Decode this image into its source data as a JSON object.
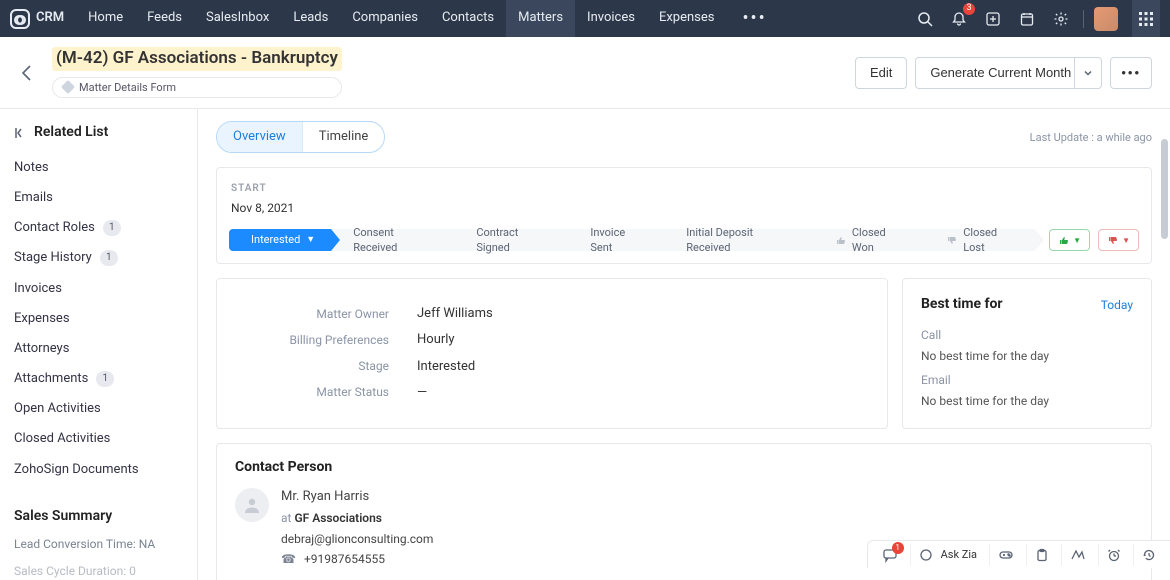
{
  "brand": "CRM",
  "nav": {
    "items": [
      "Home",
      "Feeds",
      "SalesInbox",
      "Leads",
      "Companies",
      "Contacts",
      "Matters",
      "Invoices",
      "Expenses"
    ],
    "active_index": 6
  },
  "notif_count": "3",
  "header": {
    "title": "(M-42) GF Associations - Bankruptcy",
    "tag": "Matter Details Form",
    "edit": "Edit",
    "generate": "Generate Current Month I…"
  },
  "sidebar": {
    "title": "Related List",
    "items": [
      {
        "label": "Notes"
      },
      {
        "label": "Emails"
      },
      {
        "label": "Contact Roles",
        "count": "1"
      },
      {
        "label": "Stage History",
        "count": "1"
      },
      {
        "label": "Invoices"
      },
      {
        "label": "Expenses"
      },
      {
        "label": "Attorneys"
      },
      {
        "label": "Attachments",
        "count": "1"
      },
      {
        "label": "Open Activities"
      },
      {
        "label": "Closed Activities"
      },
      {
        "label": "ZohoSign Documents"
      }
    ],
    "section": "Sales Summary",
    "kv1": "Lead Conversion Time: NA",
    "kv2": "Sales Cycle Duration: 0"
  },
  "tabs": {
    "overview": "Overview",
    "timeline": "Timeline"
  },
  "last_update": "Last Update : a while ago",
  "stage": {
    "start_label": "START",
    "start_date": "Nov 8, 2021",
    "segments": [
      "Interested",
      "Consent Received",
      "Contract Signed",
      "Invoice Sent",
      "Initial Deposit Received",
      "Closed Won",
      "Closed Lost"
    ],
    "active_index": 0
  },
  "info": {
    "rows": [
      {
        "label": "Matter Owner",
        "value": "Jeff Williams"
      },
      {
        "label": "Billing Preferences",
        "value": "Hourly"
      },
      {
        "label": "Stage",
        "value": "Interested"
      },
      {
        "label": "Matter Status",
        "value": "—"
      }
    ]
  },
  "best_time": {
    "title": "Best time for",
    "link": "Today",
    "rows": [
      {
        "label": "Call",
        "value": "No best time for the day"
      },
      {
        "label": "Email",
        "value": "No best time for the day"
      }
    ]
  },
  "contact": {
    "title": "Contact Person",
    "name": "Mr. Ryan Harris",
    "at_prefix": "at ",
    "company": "GF Associations",
    "email": "debraj@glionconsulting.com",
    "phone": "+91987654555"
  },
  "bottombar": {
    "ask": "Ask Zia",
    "chat_count": "1"
  }
}
